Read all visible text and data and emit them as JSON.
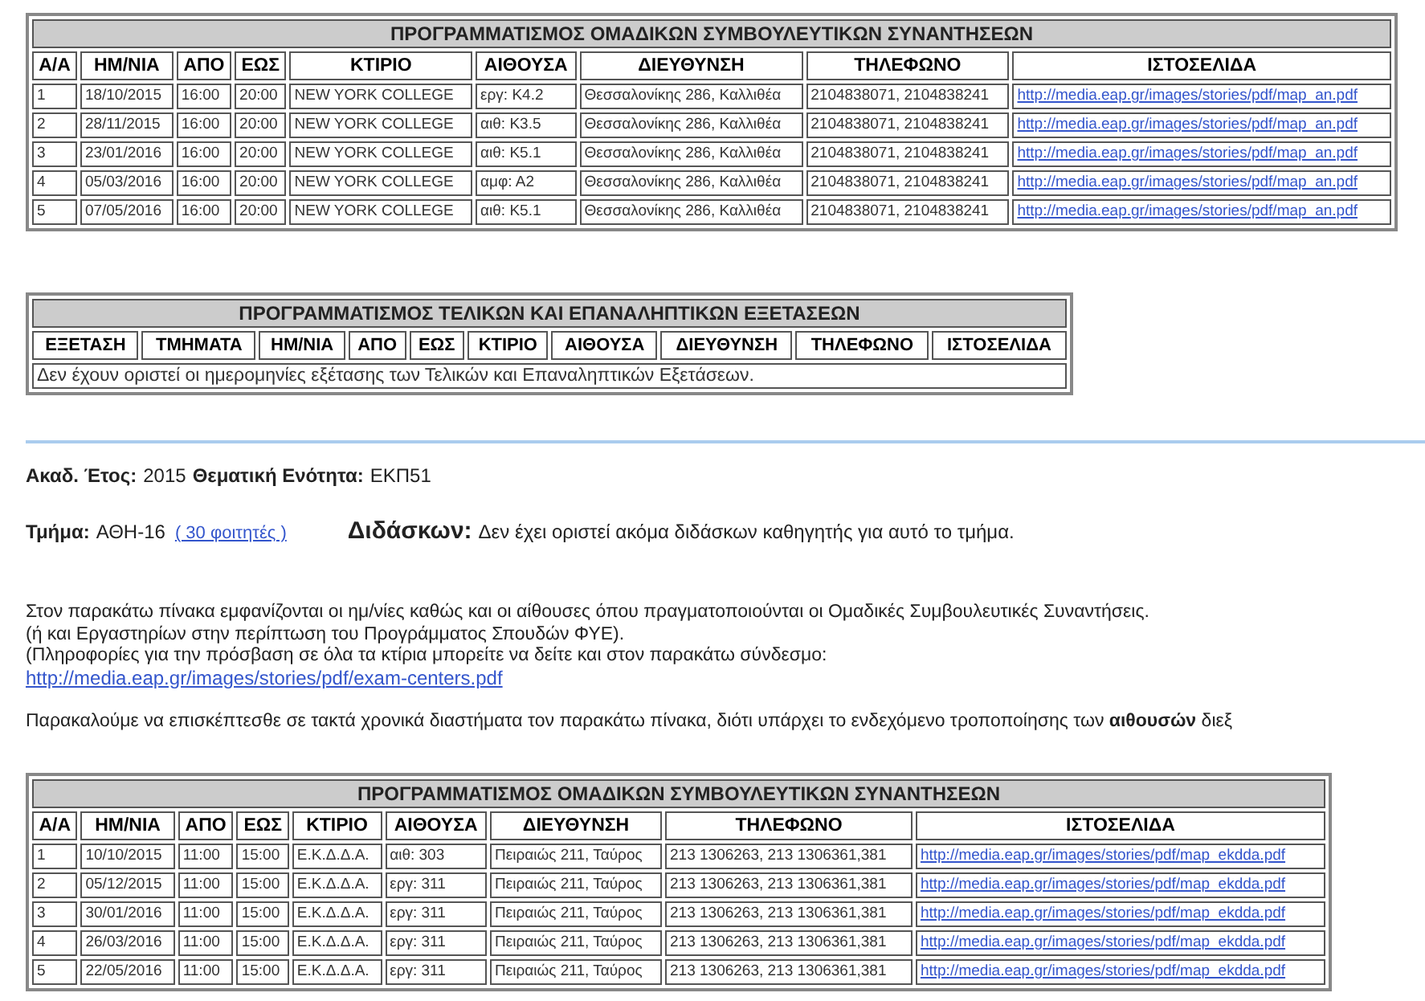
{
  "meetings_table_top": {
    "title": "ΠΡΟΓΡΑΜΜΑΤΙΣΜΟΣ ΟΜΑΔΙΚΩΝ ΣΥΜΒΟΥΛΕΥΤΙΚΩΝ ΣΥΝΑΝΤΗΣΕΩΝ",
    "columns": [
      "Α/Α",
      "ΗΜ/ΝΙΑ",
      "ΑΠΟ",
      "ΕΩΣ",
      "ΚΤΙΡΙΟ",
      "ΑΙΘΟΥΣΑ",
      "ΔΙΕΥΘΥΝΣΗ",
      "ΤΗΛΕΦΩΝΟ",
      "ΙΣΤΟΣΕΛΙΔΑ"
    ],
    "rows": [
      {
        "cells": [
          "1",
          "18/10/2015",
          "16:00",
          "20:00",
          "NEW YORK COLLEGE",
          "εργ: Κ4.2",
          "Θεσσαλονίκης 286, Καλλιθέα",
          "2104838071, 2104838241"
        ],
        "link": "http://media.eap.gr/images/stories/pdf/map_an.pdf"
      },
      {
        "cells": [
          "2",
          "28/11/2015",
          "16:00",
          "20:00",
          "NEW YORK COLLEGE",
          "αιθ: Κ3.5",
          "Θεσσαλονίκης 286, Καλλιθέα",
          "2104838071, 2104838241"
        ],
        "link": "http://media.eap.gr/images/stories/pdf/map_an.pdf"
      },
      {
        "cells": [
          "3",
          "23/01/2016",
          "16:00",
          "20:00",
          "NEW YORK COLLEGE",
          "αιθ: Κ5.1",
          "Θεσσαλονίκης 286, Καλλιθέα",
          "2104838071, 2104838241"
        ],
        "link": "http://media.eap.gr/images/stories/pdf/map_an.pdf"
      },
      {
        "cells": [
          "4",
          "05/03/2016",
          "16:00",
          "20:00",
          "NEW YORK COLLEGE",
          "αμφ: Α2",
          "Θεσσαλονίκης 286, Καλλιθέα",
          "2104838071, 2104838241"
        ],
        "link": "http://media.eap.gr/images/stories/pdf/map_an.pdf"
      },
      {
        "cells": [
          "5",
          "07/05/2016",
          "16:00",
          "20:00",
          "NEW YORK COLLEGE",
          "αιθ: Κ5.1",
          "Θεσσαλονίκης 286, Καλλιθέα",
          "2104838071, 2104838241"
        ],
        "link": "http://media.eap.gr/images/stories/pdf/map_an.pdf"
      }
    ]
  },
  "exam_table": {
    "title": "ΠΡΟΓΡΑΜΜΑΤΙΣΜΟΣ ΤΕΛΙΚΩΝ ΚΑΙ ΕΠΑΝΑΛΗΠΤΙΚΩΝ ΕΞΕΤΑΣΕΩΝ",
    "columns": [
      "ΕΞΕΤΑΣΗ",
      "ΤΜΗΜΑΤΑ",
      "ΗΜ/ΝΙΑ",
      "ΑΠΟ",
      "ΕΩΣ",
      "ΚΤΙΡΙΟ",
      "ΑΙΘΟΥΣΑ",
      "ΔΙΕΥΘΥΝΣΗ",
      "ΤΗΛΕΦΩΝΟ",
      "ΙΣΤΟΣΕΛΙΔΑ"
    ],
    "message": "Δεν έχουν οριστεί οι ημερομηνίες εξέτασης των Τελικών και Επαναληπτικών Εξετάσεων."
  },
  "course_info": {
    "year_label": "Ακαδ. Έτος:",
    "year": "2015",
    "unit_label": "Θεματική Ενότητα:",
    "unit": "ΕΚΠ51",
    "group_label": "Τμήμα:",
    "group": "ΑΘΗ-16",
    "students_link": "( 30 φοιτητές )",
    "tutor_label": "Διδάσκων:",
    "tutor": "Δεν έχει οριστεί ακόμα διδάσκων καθηγητής για αυτό το τμήμα."
  },
  "notice": {
    "lines": [
      "Στον παρακάτω πίνακα εμφανίζονται οι ημ/νίες καθώς και οι αίθουσες όπου πραγματοποιούνται οι Ομαδικές Συμβουλευτικές Συναντήσεις.",
      "(ή και Εργαστηρίων στην περίπτωση του Προγράμματος Σπουδών ΦΥΕ).",
      "(Πληροφορίες για την πρόσβαση σε όλα τα κτίρια μπορείτε να δείτε και στον παρακάτω σύνδεσμο:"
    ],
    "link": "http://media.eap.gr/images/stories/pdf/exam-centers.pdf",
    "request": "Παρακαλούμε να επισκέπτεσθε σε τακτά χρονικά διαστήματα τον παρακάτω πίνακα, διότι υπάρχει το ενδεχόμενο τροποποίησης των **αιθουσών** διεξ"
  },
  "meetings_table_bottom": {
    "title": "ΠΡΟΓΡΑΜΜΑΤΙΣΜΟΣ ΟΜΑΔΙΚΩΝ ΣΥΜΒΟΥΛΕΥΤΙΚΩΝ ΣΥΝΑΝΤΗΣΕΩΝ",
    "columns": [
      "Α/Α",
      "ΗΜ/ΝΙΑ",
      "ΑΠΟ",
      "ΕΩΣ",
      "ΚΤΙΡΙΟ",
      "ΑΙΘΟΥΣΑ",
      "ΔΙΕΥΘΥΝΣΗ",
      "ΤΗΛΕΦΩΝΟ",
      "ΙΣΤΟΣΕΛΙΔΑ"
    ],
    "rows": [
      {
        "cells": [
          "1",
          "10/10/2015",
          "11:00",
          "15:00",
          "Ε.Κ.Δ.Δ.Α.",
          "αιθ: 303",
          "Πειραιώς 211, Ταύρος",
          "213 1306263, 213 1306361,381"
        ],
        "link": "http://media.eap.gr/images/stories/pdf/map_ekdda.pdf"
      },
      {
        "cells": [
          "2",
          "05/12/2015",
          "11:00",
          "15:00",
          "Ε.Κ.Δ.Δ.Α.",
          "εργ: 311",
          "Πειραιώς 211, Ταύρος",
          "213 1306263, 213 1306361,381"
        ],
        "link": "http://media.eap.gr/images/stories/pdf/map_ekdda.pdf"
      },
      {
        "cells": [
          "3",
          "30/01/2016",
          "11:00",
          "15:00",
          "Ε.Κ.Δ.Δ.Α.",
          "εργ: 311",
          "Πειραιώς 211, Ταύρος",
          "213 1306263, 213 1306361,381"
        ],
        "link": "http://media.eap.gr/images/stories/pdf/map_ekdda.pdf"
      },
      {
        "cells": [
          "4",
          "26/03/2016",
          "11:00",
          "15:00",
          "Ε.Κ.Δ.Δ.Α.",
          "εργ: 311",
          "Πειραιώς 211, Ταύρος",
          "213 1306263, 213 1306361,381"
        ],
        "link": "http://media.eap.gr/images/stories/pdf/map_ekdda.pdf"
      },
      {
        "cells": [
          "5",
          "22/05/2016",
          "11:00",
          "15:00",
          "Ε.Κ.Δ.Δ.Α.",
          "εργ: 311",
          "Πειραιώς 211, Ταύρος",
          "213 1306263, 213 1306361,381"
        ],
        "link": "http://media.eap.gr/images/stories/pdf/map_ekdda.pdf"
      }
    ]
  }
}
